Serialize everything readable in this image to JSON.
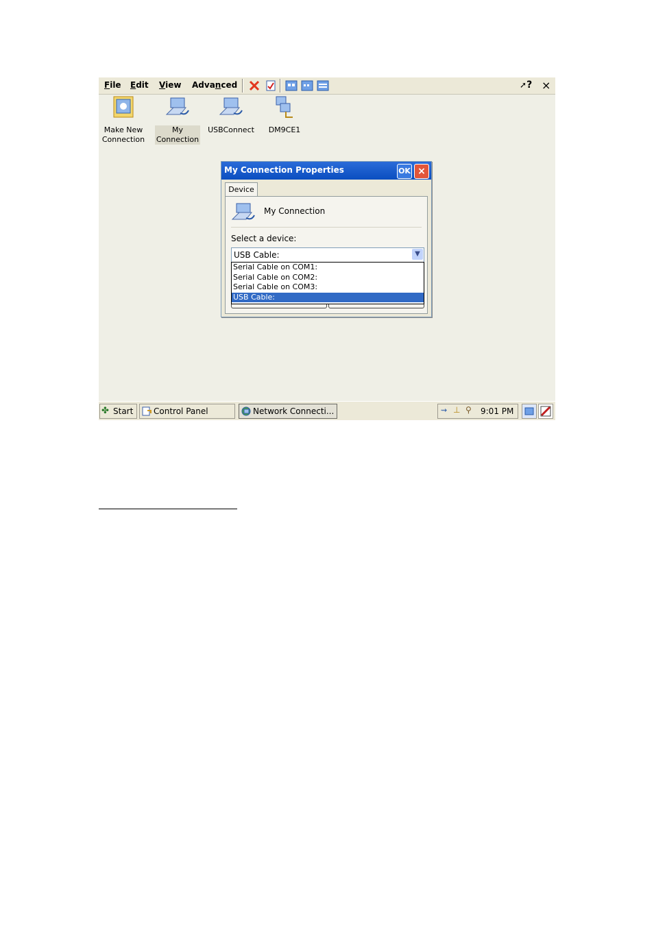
{
  "menu": {
    "items": [
      {
        "label": "File",
        "accel": "F",
        "rest": "ile"
      },
      {
        "label": "Edit",
        "accel": "E",
        "rest": "dit"
      },
      {
        "label": "View",
        "accel": "V",
        "rest": "iew"
      },
      {
        "label": "Advanced",
        "pre": "Adva",
        "accel": "n",
        "rest": "ced"
      }
    ],
    "help_label": "?",
    "close_label": "×"
  },
  "desktop": {
    "items": [
      {
        "line1": "Make New",
        "line2": "Connection",
        "icon": "make-new-connection-icon"
      },
      {
        "line1": "My",
        "line2": "Connection",
        "icon": "network-connection-icon",
        "selected": true
      },
      {
        "line1": "USBConnect",
        "line2": "",
        "icon": "network-connection-icon"
      },
      {
        "line1": "DM9CE1",
        "line2": "",
        "icon": "lan-adapter-icon"
      }
    ]
  },
  "dialog": {
    "title": "My Connection Properties",
    "ok_label": "OK",
    "close_label": "×",
    "tab_label": "Device",
    "connection_name": "My Connection",
    "select_label": "Select a device:",
    "selected_device": "USB Cable:",
    "options": [
      "Serial Cable on COM1:",
      "Serial Cable on COM2:",
      "Serial Cable on COM3:",
      "USB Cable:"
    ],
    "selected_index": 3
  },
  "taskbar": {
    "start_label": "Start",
    "tasks": [
      {
        "label": "Control Panel",
        "icon": "control-panel-icon"
      },
      {
        "label": "Network Connecti...",
        "icon": "network-icon",
        "active": true
      }
    ],
    "clock": "9:01 PM"
  },
  "colors": {
    "selection": "#316ac5",
    "titlebar": "#0a4ec0",
    "close_button": "#e2563a"
  }
}
